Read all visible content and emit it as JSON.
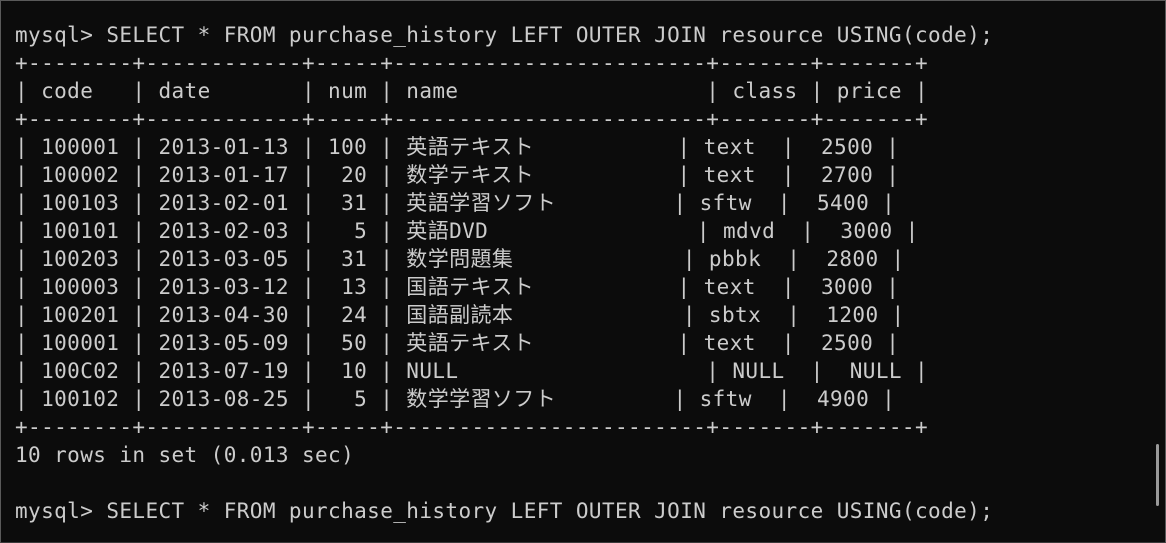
{
  "terminal": {
    "prompt": "mysql> ",
    "command": "SELECT * FROM purchase_history LEFT OUTER JOIN resource USING(code);",
    "table_lines": [
      "+--------+------------+-----+------------------------+-------+-------+",
      "| code   | date       | num | name                   | class | price |",
      "+--------+------------+-----+------------------------+-------+-------+",
      "| 100001 | 2013-01-13 | 100 | 英語テキスト           | text  |  2500 |",
      "| 100002 | 2013-01-17 |  20 | 数学テキスト           | text  |  2700 |",
      "| 100103 | 2013-02-01 |  31 | 英語学習ソフト         | sftw  |  5400 |",
      "| 100101 | 2013-02-03 |   5 | 英語DVD                | mdvd  |  3000 |",
      "| 100203 | 2013-03-05 |  31 | 数学問題集             | pbbk  |  2800 |",
      "| 100003 | 2013-03-12 |  13 | 国語テキスト           | text  |  3000 |",
      "| 100201 | 2013-04-30 |  24 | 国語副読本             | sbtx  |  1200 |",
      "| 100001 | 2013-05-09 |  50 | 英語テキスト           | text  |  2500 |",
      "| 100C02 | 2013-07-19 |  10 | NULL                   | NULL  |  NULL |",
      "| 100102 | 2013-08-25 |   5 | 数学学習ソフト         | sftw  |  4900 |",
      "+--------+------------+-----+------------------------+-------+-------+"
    ],
    "result_summary": "10 rows in set (0.013 sec)",
    "blank": "",
    "final_prompt": "mysql> ",
    "final_command": "SELECT * FROM purchase_history LEFT OUTER JOIN resource USING(code);"
  },
  "colors": {
    "background": "#0c0c0c",
    "text": "#cccccc"
  }
}
